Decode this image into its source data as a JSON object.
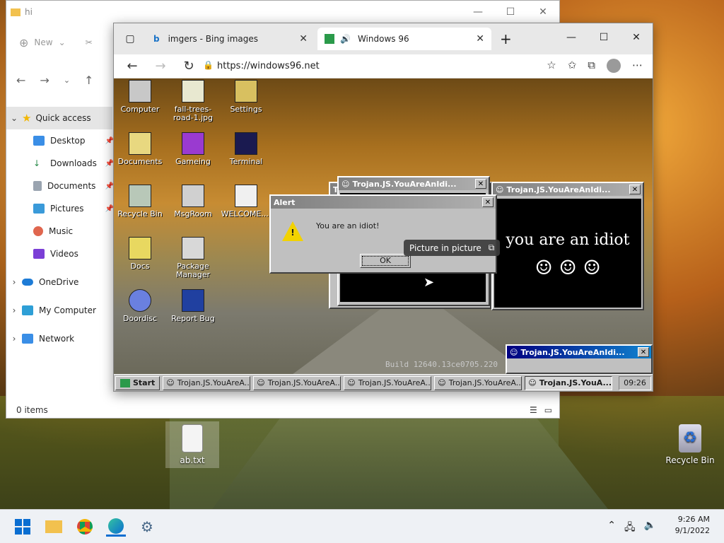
{
  "desktop": {
    "icons": [
      {
        "label": "ab.txt"
      },
      {
        "label": "Recycle Bin"
      }
    ]
  },
  "explorer": {
    "title": "hi",
    "toolbar": {
      "new_label": "New"
    },
    "nav": [
      {
        "label": "Quick access"
      },
      {
        "label": "Desktop"
      },
      {
        "label": "Downloads"
      },
      {
        "label": "Documents"
      },
      {
        "label": "Pictures"
      },
      {
        "label": "Music"
      },
      {
        "label": "Videos"
      },
      {
        "label": "OneDrive"
      },
      {
        "label": "My Computer"
      },
      {
        "label": "Network"
      }
    ],
    "status": "0 items"
  },
  "browser": {
    "tabs": [
      {
        "label": "imgers - Bing images"
      },
      {
        "label": "Windows 96"
      }
    ],
    "url": "https://windows96.net"
  },
  "w96": {
    "icons": [
      {
        "label": "Computer"
      },
      {
        "label": "fall-trees-road-1.jpg"
      },
      {
        "label": "Settings"
      },
      {
        "label": "Documents"
      },
      {
        "label": "Gameing"
      },
      {
        "label": "Terminal"
      },
      {
        "label": "Recycle Bin"
      },
      {
        "label": "MsgRoom"
      },
      {
        "label": "WELCOME...."
      },
      {
        "label": "Docs"
      },
      {
        "label": "Package Manager"
      },
      {
        "label": "Doordisc"
      },
      {
        "label": "Report Bug"
      }
    ],
    "build": "Build 12640.13ce0705.220",
    "trojan_title": "Trojan.JS.YouAreAnIdi...",
    "alert": {
      "title": "Alert",
      "message": "You are an idiot!",
      "ok": "OK"
    },
    "idiot": {
      "text": "you are an idiot",
      "smileys": "☺  ☺  ☺"
    },
    "pip": "Picture in picture",
    "taskbar": {
      "start": "Start",
      "items": [
        {
          "label": "Trojan.JS.YouAreA..."
        },
        {
          "label": "Trojan.JS.YouAreA..."
        },
        {
          "label": "Trojan.JS.YouAreA..."
        },
        {
          "label": "Trojan.JS.YouAreA..."
        },
        {
          "label": "Trojan.JS.YouA..."
        }
      ],
      "clock": "09:26"
    }
  },
  "taskbar": {
    "time": "9:26 AM",
    "date": "9/1/2022"
  }
}
